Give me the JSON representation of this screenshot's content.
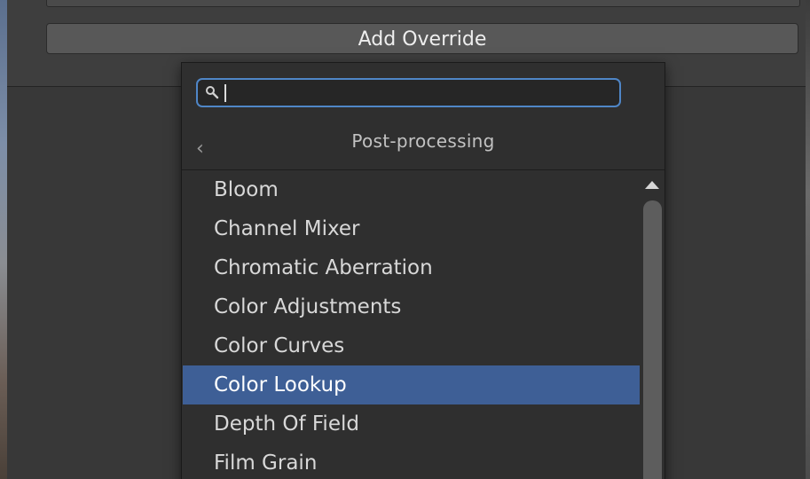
{
  "inspector": {
    "add_override_label": "Add Override"
  },
  "popup": {
    "search": {
      "value": "",
      "placeholder": ""
    },
    "header": {
      "back_icon": "chevron-left-icon",
      "title": "Post-processing"
    },
    "items": [
      {
        "label": "Bloom",
        "selected": false
      },
      {
        "label": "Channel Mixer",
        "selected": false
      },
      {
        "label": "Chromatic Aberration",
        "selected": false
      },
      {
        "label": "Color Adjustments",
        "selected": false
      },
      {
        "label": "Color Curves",
        "selected": false
      },
      {
        "label": "Color Lookup",
        "selected": true
      },
      {
        "label": "Depth Of Field",
        "selected": false
      },
      {
        "label": "Film Grain",
        "selected": false
      }
    ]
  },
  "colors": {
    "selection": "#3e5f96",
    "search_focus": "#4f86c7",
    "panel": "#2f2f2f"
  }
}
